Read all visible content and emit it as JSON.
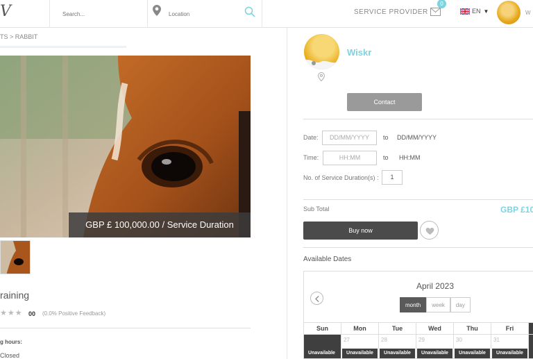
{
  "header": {
    "logo_text": "V",
    "search_placeholder": "Search...",
    "location_placeholder": "Location",
    "service_provider_label": "SERVICE PROVIDER",
    "mail_badge_count": "0",
    "language": "EN",
    "user_name_partial": "W",
    "icons": [
      "location-pin-icon",
      "search-icon",
      "mail-icon",
      "uk-flag-icon",
      "chevron-down-icon"
    ]
  },
  "listing": {
    "breadcrumb": "TS > RABBIT",
    "price_label": "GBP £ 100,000.00 / Service Duration",
    "title": "raining",
    "stars": "★★★",
    "rating_count": "00",
    "feedback": "(0.0% Positive Feedback)",
    "hours_label": "g hours:",
    "hours_value": "Closed"
  },
  "provider": {
    "name": "Wiskr",
    "contact_label": "Contact"
  },
  "booking": {
    "date_label": "Date:",
    "date_from_placeholder": "DD/MM/YYYY",
    "to_label": "to",
    "date_to_value": "DD/MM/YYYY",
    "time_label": "Time:",
    "time_from_placeholder": "HH:MM",
    "time_to_value": "HH:MM",
    "duration_label": "No. of Service Duration(s) :",
    "duration_value": "1",
    "subtotal_label": "Sub Total",
    "subtotal_value": "GBP £10",
    "buy_label": "Buy now"
  },
  "calendar": {
    "section_label": "Available Dates",
    "month_title": "April 2023",
    "views": [
      "month",
      "week",
      "day"
    ],
    "active_view": "month",
    "day_headers": [
      "Sun",
      "Mon",
      "Tue",
      "Wed",
      "Thu",
      "Fri"
    ],
    "first_row": [
      {
        "day": "",
        "status": "Unavailable"
      },
      {
        "day": "27",
        "status": "Unavailable"
      },
      {
        "day": "28",
        "status": "Unavailable"
      },
      {
        "day": "29",
        "status": "Unavailable"
      },
      {
        "day": "30",
        "status": "Unavailable"
      },
      {
        "day": "31",
        "status": "Unavailable"
      }
    ]
  },
  "colors": {
    "accent": "#7dd3e0",
    "dark_button": "#4b4b4b",
    "grey_button": "#9a9a9a"
  }
}
